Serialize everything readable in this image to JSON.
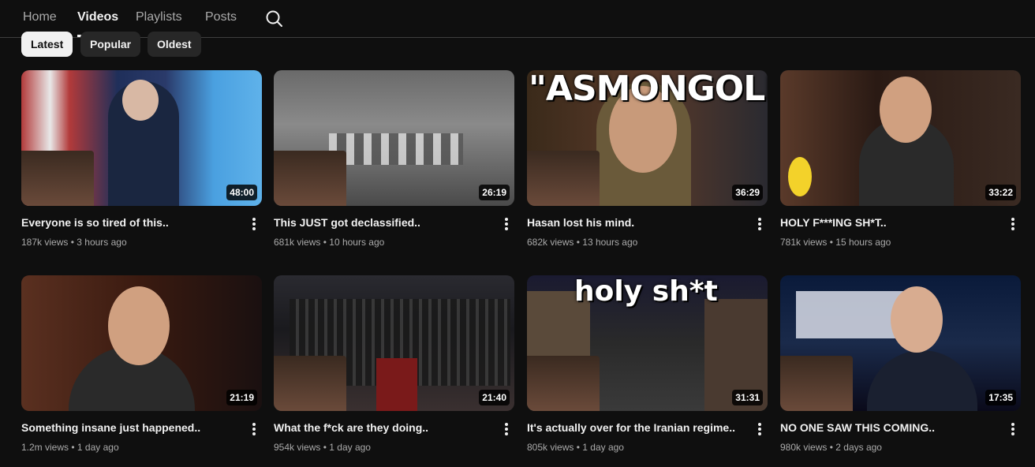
{
  "tabs": [
    {
      "label": "Home",
      "active": false
    },
    {
      "label": "Videos",
      "active": true
    },
    {
      "label": "Playlists",
      "active": false
    },
    {
      "label": "Posts",
      "active": false
    }
  ],
  "search_icon": "search-icon",
  "chips": [
    {
      "label": "Latest",
      "selected": true
    },
    {
      "label": "Popular",
      "selected": false
    },
    {
      "label": "Oldest",
      "selected": false
    }
  ],
  "videos": [
    {
      "title": "Everyone is so tired of this..",
      "views": "187k views",
      "age": "3 hours ago",
      "duration": "48:00"
    },
    {
      "title": "This JUST got declassified..",
      "views": "681k views",
      "age": "10 hours ago",
      "duration": "26:19"
    },
    {
      "title": "Hasan lost his mind.",
      "views": "682k views",
      "age": "13 hours ago",
      "duration": "36:29",
      "overlay": "\"ASMONGOLD\""
    },
    {
      "title": "HOLY F***ING SH*T..",
      "views": "781k views",
      "age": "15 hours ago",
      "duration": "33:22"
    },
    {
      "title": "Something insane just happened..",
      "views": "1.2m views",
      "age": "1 day ago",
      "duration": "21:19"
    },
    {
      "title": "What the f*ck are they doing..",
      "views": "954k views",
      "age": "1 day ago",
      "duration": "21:40"
    },
    {
      "title": "It's actually over for the Iranian regime..",
      "views": "805k views",
      "age": "1 day ago",
      "duration": "31:31",
      "overlay": "holy sh*t"
    },
    {
      "title": "NO ONE SAW THIS COMING..",
      "views": "980k views",
      "age": "2 days ago",
      "duration": "17:35"
    }
  ],
  "separator": "•"
}
